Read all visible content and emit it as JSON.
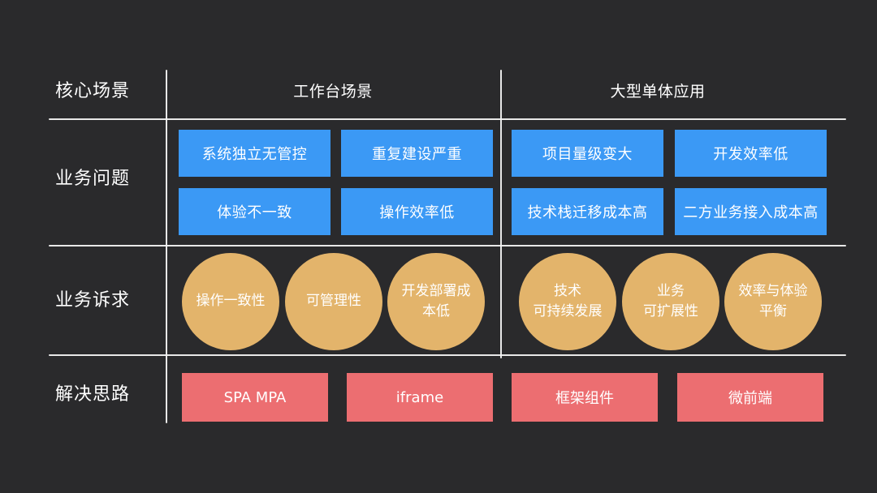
{
  "rows": {
    "core_scene": "核心场景",
    "business_problems": "业务问题",
    "business_demands": "业务诉求",
    "solutions": "解决思路"
  },
  "columns": {
    "workbench": "工作台场景",
    "monolith": "大型单体应用"
  },
  "problems": [
    "系统独立无管控",
    "重复建设严重",
    "项目量级变大",
    "开发效率低",
    "体验不一致",
    "操作效率低",
    "技术栈迁移成本高",
    "二方业务接入成本高"
  ],
  "demands": [
    "操作一致性",
    "可管理性",
    "开发部署成\n本低",
    "技术\n可持续发展",
    "业务\n可扩展性",
    "效率与体验\n平衡"
  ],
  "solutions": [
    "SPA MPA",
    "iframe",
    "框架组件",
    "微前端"
  ],
  "colors": {
    "background": "#2a2a2c",
    "problem_box": "#3b99f5",
    "demand_circle": "#e3b46b",
    "solution_box": "#ec6e71",
    "line": "#f2f2f2"
  }
}
